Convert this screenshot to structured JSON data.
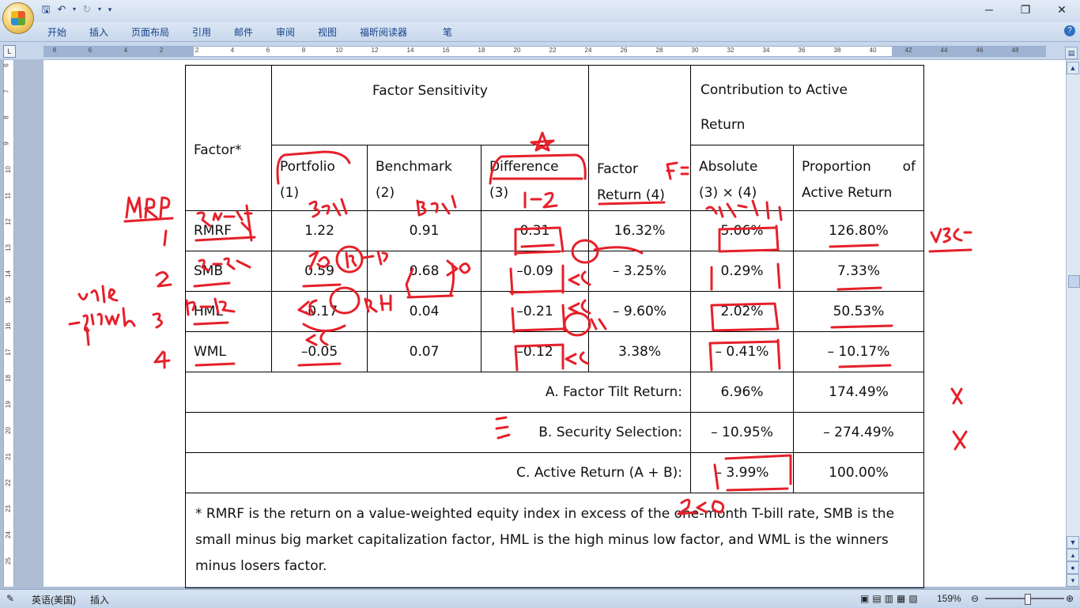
{
  "ribbon": {
    "tabs": [
      "开始",
      "插入",
      "页面布局",
      "引用",
      "邮件",
      "审阅",
      "视图",
      "福昕阅读器",
      "笔"
    ]
  },
  "table": {
    "header": {
      "factor": "Factor*",
      "factor_sensitivity": "Factor Sensitivity",
      "portfolio": "Portfolio",
      "portfolio_num": "(1)",
      "benchmark": "Benchmark",
      "benchmark_num": "(2)",
      "difference": "Difference",
      "difference_num": "(3)",
      "factor_return": "Factor",
      "factor_return_2": "Return (4)",
      "contribution": "Contribution to Active",
      "contribution_2": "Return",
      "absolute": "Absolute",
      "absolute_2": "(3) × (4)",
      "proportion": "Proportion of",
      "proportion_2": "Active Return"
    },
    "rows": [
      {
        "factor": "RMRF",
        "portfolio": "1.22",
        "benchmark": "0.91",
        "difference": "0.31",
        "factor_return": "16.32%",
        "absolute": "5.06%",
        "proportion": "126.80%"
      },
      {
        "factor": "SMB",
        "portfolio": "0.59",
        "benchmark": "0.68",
        "difference": "–0.09",
        "factor_return": "– 3.25%",
        "absolute": "0.29%",
        "proportion": "7.33%"
      },
      {
        "factor": "HML",
        "portfolio": "–0.17",
        "benchmark": "0.04",
        "difference": "–0.21",
        "factor_return": "– 9.60%",
        "absolute": "2.02%",
        "proportion": "50.53%"
      },
      {
        "factor": "WML",
        "portfolio": "–0.05",
        "benchmark": "0.07",
        "difference": "–0.12",
        "factor_return": "3.38%",
        "absolute": "– 0.41%",
        "proportion": "– 10.17%"
      }
    ],
    "summary": [
      {
        "label": "A. Factor Tilt Return:",
        "absolute": "6.96%",
        "proportion": "174.49%"
      },
      {
        "label": "B. Security Selection:",
        "absolute": "– 10.95%",
        "proportion": "– 274.49%"
      },
      {
        "label": "C. Active Return (A + B):",
        "absolute": "– 3.99%",
        "proportion": "100.00%"
      }
    ],
    "footnote": "* RMRF is the return on a value-weighted equity index in excess of the one-month T-bill rate, SMB is the small minus big market capitalization factor, HML is the high minus low factor, and WML is the winners minus losers factor."
  },
  "statusbar": {
    "language": "英语(美国)",
    "mode": "插入",
    "zoom": "159%"
  },
  "ink_color": "#e5202a"
}
